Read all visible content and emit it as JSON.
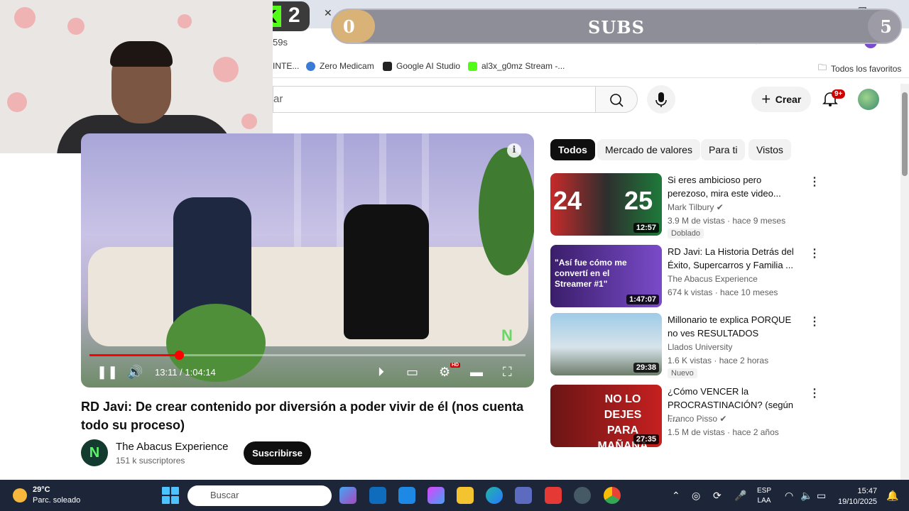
{
  "browser": {
    "tab_fragment": "59s",
    "bookmarks": [
      {
        "label": "INTE...",
        "color": "#c6c6c6"
      },
      {
        "label": "Zero Medicam",
        "color": "#3a7bd5"
      },
      {
        "label": "Google AI Studio",
        "color": "#222222"
      },
      {
        "label": "al3x_g0mz Stream -...",
        "color": "#53fc18"
      }
    ],
    "bookmarks_folder": "Todos los favoritos"
  },
  "overlay": {
    "kick_count": "2",
    "subs_label": "SUBS",
    "left_value": "0",
    "right_value": "5"
  },
  "youtube": {
    "search_placeholder": "ar",
    "create_label": "Crear",
    "notifications": "9+",
    "chips": [
      "Todos",
      "Mercado de valores",
      "Para ti",
      "Vistos"
    ],
    "player": {
      "time": "13:11 / 1:04:14",
      "progress": 0.205
    },
    "video_title": "RD Javi: De crear contenido por diversión a poder vivir de él (nos cuenta todo su proceso)",
    "channel": {
      "name": "The Abacus Experience",
      "subs": "151 k suscriptores",
      "subscribe": "Suscribirse"
    },
    "recommendations": [
      {
        "title": "Si eres ambicioso pero perezoso, mira este video...",
        "channel": "Mark Tilbury",
        "verified": true,
        "meta": "3.9 M de vistas · hace 9 meses",
        "badge": "Doblado",
        "duration": "12:57",
        "thumb_text": "24      25"
      },
      {
        "title": "RD Javi: La Historia Detrás del Éxito, Supercarros y Familia ...",
        "channel": "The Abacus Experience",
        "meta": "674 k vistas · hace 10 meses",
        "duration": "1:47:07",
        "thumb_text": "\"Así fue cómo me convertí en el Streamer #1\""
      },
      {
        "title": "Millonario te explica PORQUE no ves RESULTADOS",
        "channel": "Llados University",
        "meta": "1.6 K vistas · hace 2 horas",
        "badge": "Nuevo",
        "duration": "29:38"
      },
      {
        "title": "¿Cómo VENCER la PROCRASTINACIÓN? (según l...",
        "channel": "Franco Pisso",
        "verified": true,
        "meta": "1.5 M de vistas · hace 2 años",
        "duration": "27:35",
        "thumb_text": "NO LO DEJES PARA MAÑANA"
      }
    ]
  },
  "taskbar": {
    "temp": "29°C",
    "condition": "Parc. soleado",
    "search": "Buscar",
    "lang_1": "ESP",
    "lang_2": "LAA",
    "time": "15:47",
    "date": "19/10/2025"
  }
}
